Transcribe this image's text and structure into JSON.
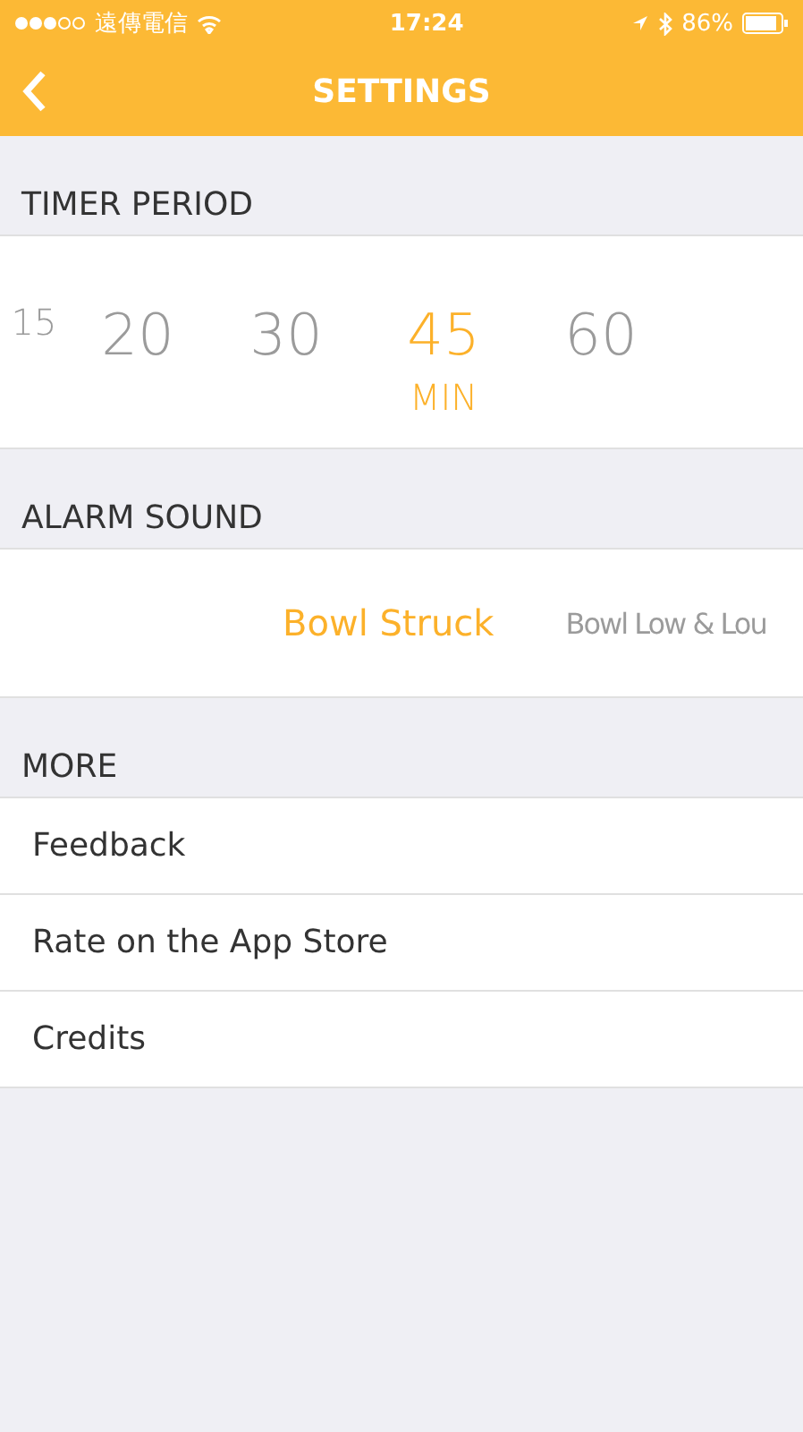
{
  "status_bar": {
    "carrier": "遠傳電信",
    "time": "17:24",
    "battery": "86%"
  },
  "nav": {
    "title": "SETTINGS"
  },
  "timer": {
    "header": "TIMER PERIOD",
    "unit": "MIN",
    "options": [
      {
        "label": "15",
        "selected": false
      },
      {
        "label": "20",
        "selected": false
      },
      {
        "label": "30",
        "selected": false
      },
      {
        "label": "45",
        "selected": true
      },
      {
        "label": "60",
        "selected": false
      }
    ]
  },
  "alarm": {
    "header": "ALARM SOUND",
    "options": [
      {
        "label": "Bowl Struck",
        "selected": true
      },
      {
        "label": "Bowl Low & Lou",
        "selected": false
      }
    ]
  },
  "more": {
    "header": "MORE",
    "items": [
      "Feedback",
      "Rate on the App Store",
      "Credits"
    ]
  }
}
